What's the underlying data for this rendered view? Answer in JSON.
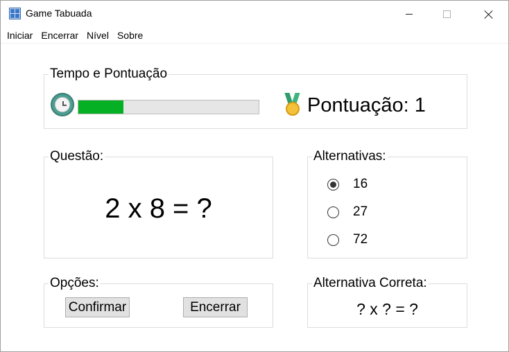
{
  "window": {
    "title": "Game Tabuada"
  },
  "menu": [
    "Iniciar",
    "Encerrar",
    "Nível",
    "Sobre"
  ],
  "tempo": {
    "group_title": "Tempo e Pontuação",
    "progress_fraction": 0.25,
    "progress_color": "#06b025",
    "score_text": "Pontuação: 1"
  },
  "questao": {
    "group_title": "Questão:",
    "text": "2 x 8 = ?"
  },
  "alternativas": {
    "group_title": "Alternativas:",
    "options": [
      {
        "label": "16",
        "selected": true
      },
      {
        "label": "27",
        "selected": false
      },
      {
        "label": "72",
        "selected": false
      }
    ]
  },
  "opcoes": {
    "group_title": "Opções:",
    "confirm_label": "Confirmar",
    "end_label": "Encerrar"
  },
  "correta": {
    "group_title": "Alternativa Correta:",
    "text": "? x ? = ?"
  }
}
